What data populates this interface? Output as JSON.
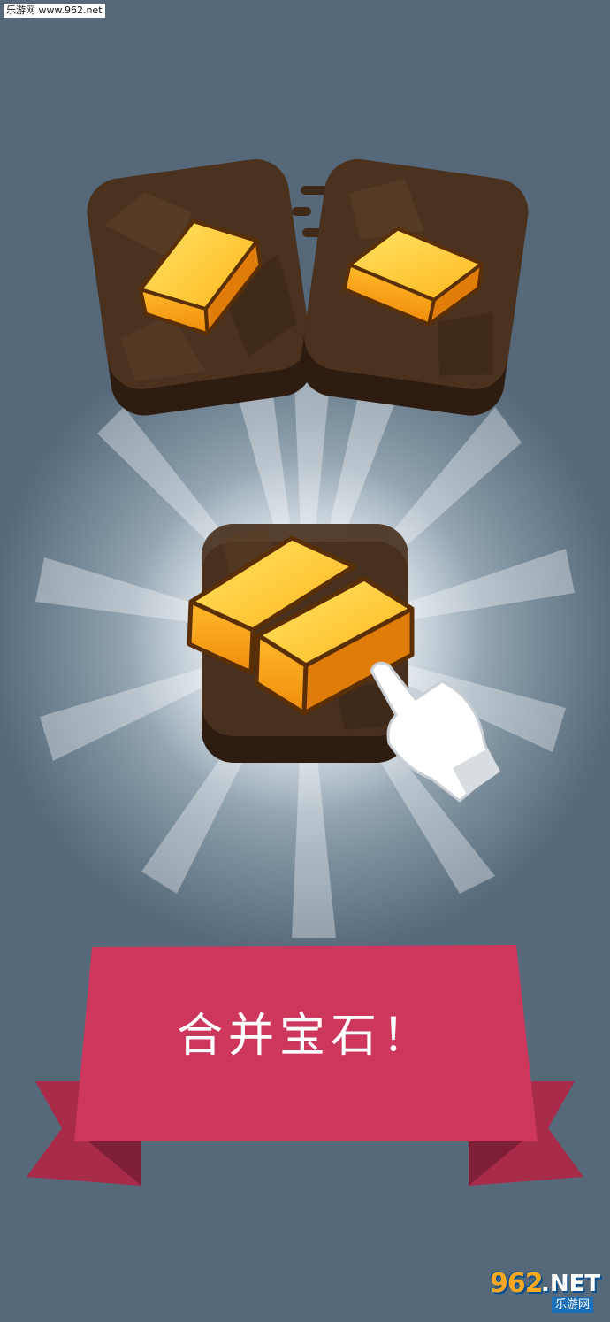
{
  "watermark": {
    "text": "乐游网 www.962.net"
  },
  "banner": {
    "title": "合并宝石！"
  },
  "logo": {
    "main": "962",
    "net": ".NET",
    "sub": "乐游网"
  },
  "colors": {
    "background": "#4e6173",
    "tile": "#4a321f",
    "tile_base": "#2e1c10",
    "gold": "#f5a516",
    "gold_light": "#ffd23a",
    "banner": "#cd375c",
    "banner_tail": "#a82c4a",
    "hand": "#ffffff"
  },
  "icons": {
    "left_tile": "gold-bar-icon",
    "right_tile": "gold-bar-icon",
    "merged_tile": "double-gold-bar-icon",
    "pointer": "tap-hand-icon"
  }
}
